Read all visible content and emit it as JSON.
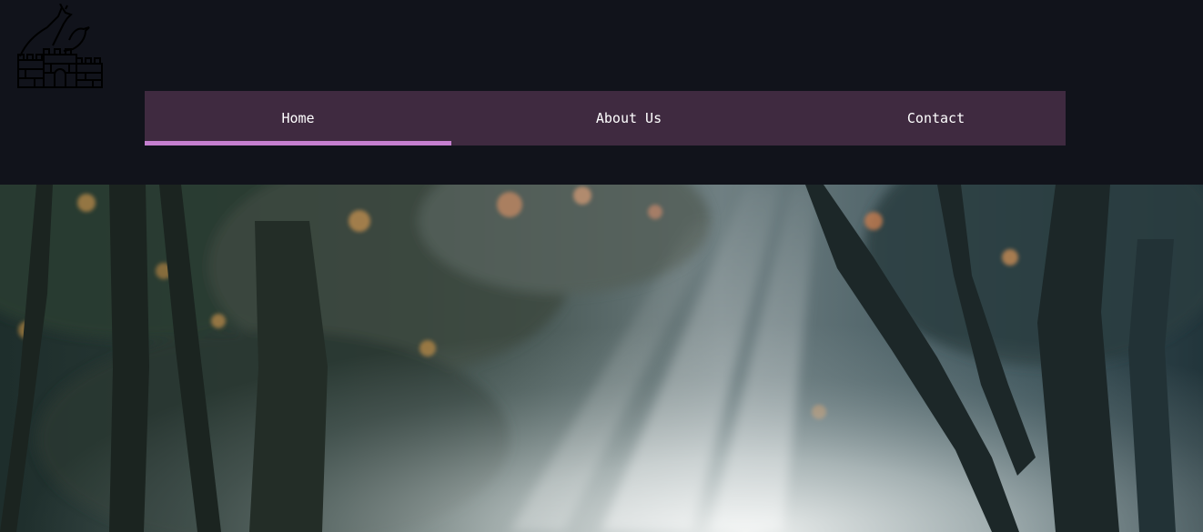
{
  "colors": {
    "header_bg": "#11131b",
    "nav_bg": "#3f2a40",
    "nav_active_indicator": "#c57fd0",
    "nav_text": "#ffffff"
  },
  "logo": {
    "icon": "castle-with-giraffe-and-bird-logo"
  },
  "nav": {
    "items": [
      {
        "label": "Home",
        "active": true
      },
      {
        "label": "About Us",
        "active": false
      },
      {
        "label": "Contact",
        "active": false
      }
    ]
  },
  "hero": {
    "image": "misty-forest-sunbeams-photo"
  }
}
